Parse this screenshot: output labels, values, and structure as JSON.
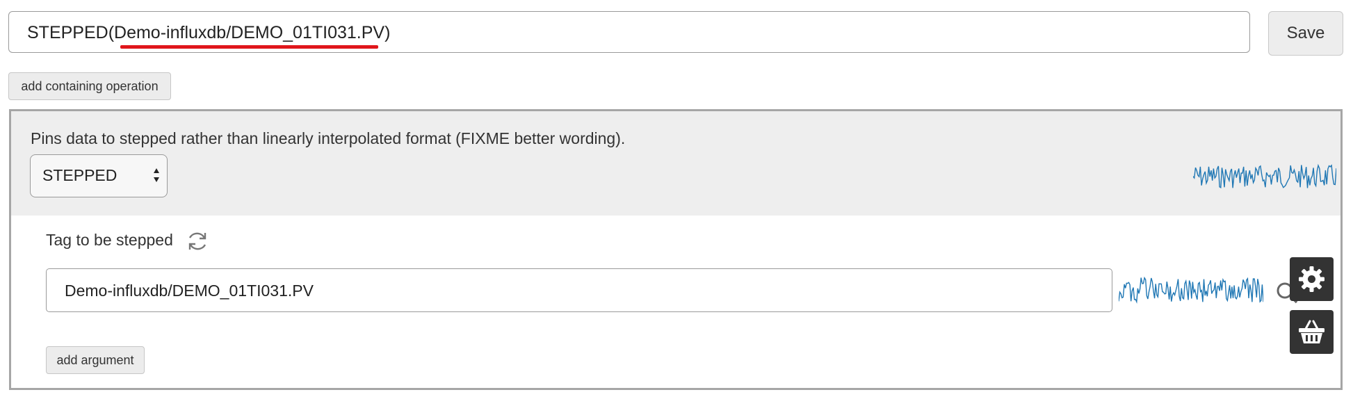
{
  "expression": {
    "text": "STEPPED(Demo-influxdb/DEMO_01TI031.PV)"
  },
  "toolbar": {
    "save_label": "Save",
    "add_containing_label": "add containing operation"
  },
  "operation": {
    "description": "Pins data to stepped rather than linearly interpolated format (FIXME better wording).",
    "selected": "STEPPED"
  },
  "argument": {
    "label": "Tag to be stepped",
    "value": "Demo-influxdb/DEMO_01TI031.PV",
    "add_label": "add argument"
  },
  "colors": {
    "sparkline": "#1f77b4",
    "underline": "#e0161b",
    "icon_button_bg": "#333333"
  },
  "icons": [
    "refresh-icon",
    "search-icon",
    "gear-icon",
    "basket-icon"
  ]
}
